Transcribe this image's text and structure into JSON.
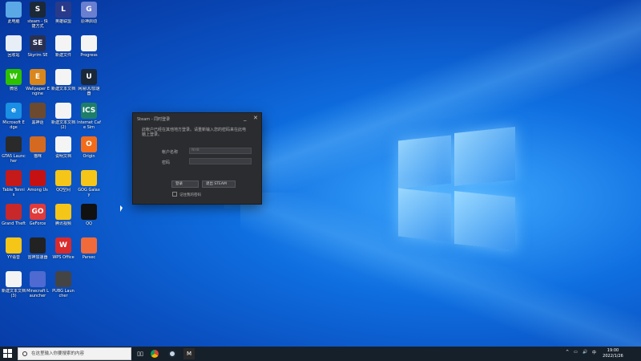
{
  "desktop": {
    "icons": [
      {
        "label": "此电脑",
        "color": "#5aa9e6",
        "glyph": ""
      },
      {
        "label": "steam - 快捷方式",
        "color": "#1b2838",
        "glyph": "S"
      },
      {
        "label": "英雄联盟",
        "color": "#2a3a8a",
        "glyph": "L"
      },
      {
        "label": "原神启动",
        "color": "#6a7fd0",
        "glyph": "G"
      },
      {
        "label": "回收站",
        "color": "#e8eef5",
        "glyph": ""
      },
      {
        "label": "Skyrim SE",
        "color": "#2a3050",
        "glyph": "SE"
      },
      {
        "label": "新建文件",
        "color": "#f4f4f4",
        "glyph": ""
      },
      {
        "label": "Progress",
        "color": "#f4f4f4",
        "glyph": ""
      },
      {
        "label": "微信",
        "color": "#2dc100",
        "glyph": "W"
      },
      {
        "label": "Wallpaper Engine",
        "color": "#d9861c",
        "glyph": "E"
      },
      {
        "label": "新建文本文档",
        "color": "#f4f4f4",
        "glyph": ""
      },
      {
        "label": "网易UU加速器",
        "color": "#1b2838",
        "glyph": "U"
      },
      {
        "label": "Microsoft Edge",
        "color": "#1a8fe3",
        "glyph": "e"
      },
      {
        "label": "黑神话",
        "color": "#6b4a2f",
        "glyph": ""
      },
      {
        "label": "新建文本文档(2)",
        "color": "#f4f4f4",
        "glyph": ""
      },
      {
        "label": "Internet Cafe Sim",
        "color": "#1e7e6a",
        "glyph": "ICS"
      },
      {
        "label": "GTA5 Launcher",
        "color": "#2a2a2a",
        "glyph": ""
      },
      {
        "label": "猫咪",
        "color": "#d46a1f",
        "glyph": ""
      },
      {
        "label": "说明文档",
        "color": "#f4f4f4",
        "glyph": ""
      },
      {
        "label": "Origin",
        "color": "#f26c1a",
        "glyph": "O"
      },
      {
        "label": "Table Tennis",
        "color": "#c41a1a",
        "glyph": ""
      },
      {
        "label": "Among Us",
        "color": "#c51111",
        "glyph": ""
      },
      {
        "label": "QQ空间",
        "color": "#f5c518",
        "glyph": ""
      },
      {
        "label": "GOG Galaxy",
        "color": "#f5c518",
        "glyph": ""
      },
      {
        "label": "Grand Theft",
        "color": "#c8282a",
        "glyph": ""
      },
      {
        "label": "GeForce",
        "color": "#e03a3a",
        "glyph": "GO"
      },
      {
        "label": "腾讯视频",
        "color": "#f5c518",
        "glyph": ""
      },
      {
        "label": "QQ",
        "color": "#111",
        "glyph": ""
      },
      {
        "label": "YY语音",
        "color": "#f5c518",
        "glyph": ""
      },
      {
        "label": "雷神加速器",
        "color": "#222",
        "glyph": ""
      },
      {
        "label": "WPS Office",
        "color": "#d92b2b",
        "glyph": "W"
      },
      {
        "label": "Parsec",
        "color": "#f06a3a",
        "glyph": ""
      },
      {
        "label": "新建文本文档(3)",
        "color": "#f4f4f4",
        "glyph": ""
      },
      {
        "label": "Minecraft Launcher",
        "color": "#4f6ad0",
        "glyph": ""
      },
      {
        "label": "PUBG Launcher",
        "color": "#444",
        "glyph": ""
      }
    ]
  },
  "dialog": {
    "title": "Steam - 同时登录",
    "message": "此帐户已经在其他地方登录。请重新输入您的密码来在此电脑上登录。",
    "username_label": "帐户名称",
    "username_value": "NH8",
    "password_label": "密码",
    "password_value": "",
    "login_button": "登录",
    "quit_button": "退出 STEAM",
    "remember_label": "记住我的密码",
    "minimize": "_",
    "close": "✕"
  },
  "taskbar": {
    "search_placeholder": "在这里输入你要搜索的内容",
    "tray_chevron": "^",
    "tray_monitor": "▭",
    "tray_volume": "🔊",
    "tray_ime": "中",
    "clock_time": "19:00",
    "clock_date": "2022/1/26"
  }
}
